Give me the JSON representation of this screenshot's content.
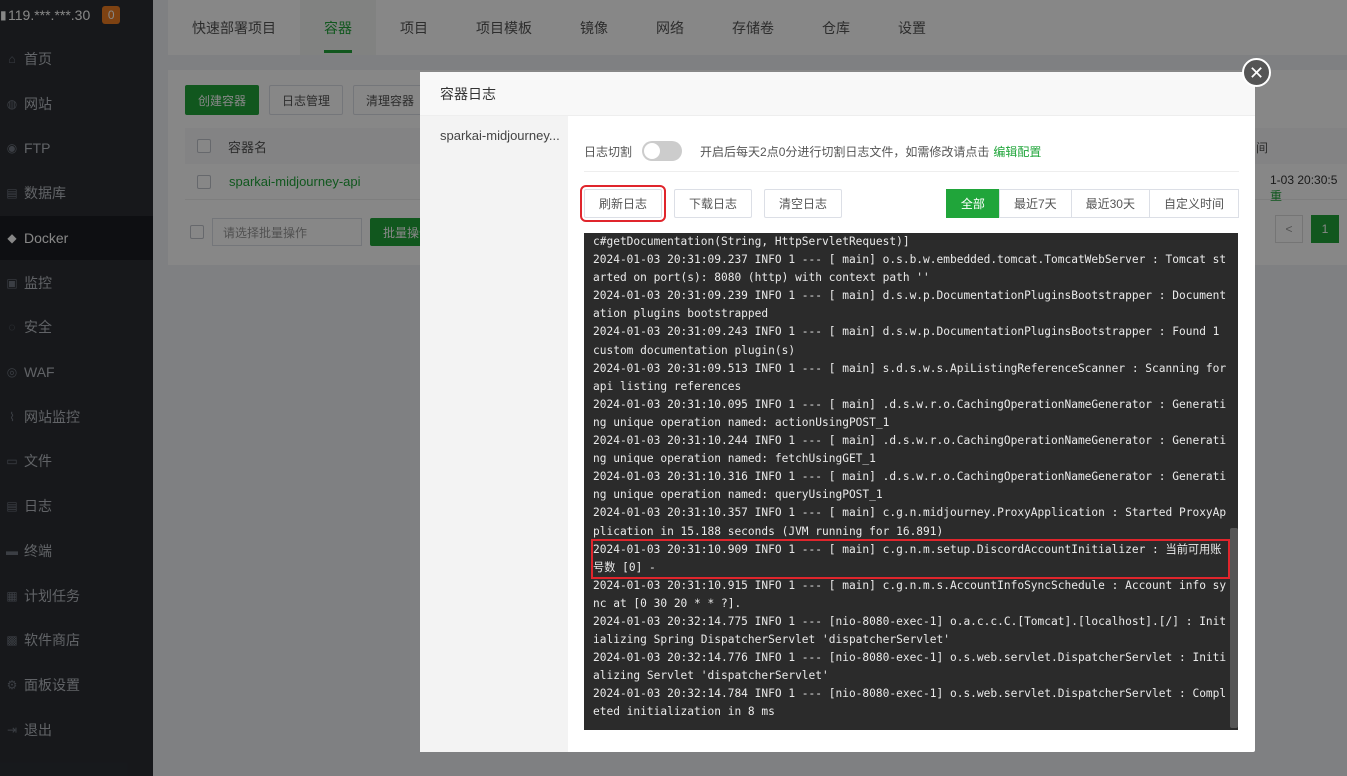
{
  "sidebar": {
    "server_ip": "119.***.***.30",
    "badge_count": "0",
    "items": [
      {
        "icon": "home-icon",
        "label": "首页"
      },
      {
        "icon": "globe-icon",
        "label": "网站"
      },
      {
        "icon": "ftp-icon",
        "label": "FTP"
      },
      {
        "icon": "database-icon",
        "label": "数据库"
      },
      {
        "icon": "docker-icon",
        "label": "Docker"
      },
      {
        "icon": "monitor-icon",
        "label": "监控"
      },
      {
        "icon": "shield-icon",
        "label": "安全"
      },
      {
        "icon": "waf-icon",
        "label": "WAF"
      },
      {
        "icon": "chart-icon",
        "label": "网站监控"
      },
      {
        "icon": "folder-icon",
        "label": "文件"
      },
      {
        "icon": "log-icon",
        "label": "日志"
      },
      {
        "icon": "terminal-icon",
        "label": "终端"
      },
      {
        "icon": "calendar-icon",
        "label": "计划任务"
      },
      {
        "icon": "grid-icon",
        "label": "软件商店"
      },
      {
        "icon": "settings-icon",
        "label": "面板设置"
      },
      {
        "icon": "logout-icon",
        "label": "退出"
      }
    ],
    "active_index": 4
  },
  "topbar": {
    "tabs": [
      "快速部署项目",
      "容器",
      "项目",
      "项目模板",
      "镜像",
      "网络",
      "存储卷",
      "仓库",
      "设置"
    ],
    "active_index": 1
  },
  "main": {
    "create_button": "创建容器",
    "log_manage_button": "日志管理",
    "clean_button": "清理容器",
    "col_name": "容器名",
    "col_time_partial": "间",
    "row_name": "sparkai-midjourney-api",
    "row_time_partial": "1-03 20:30:5",
    "row_status_partial": "重",
    "batch_placeholder": "请选择批量操作",
    "batch_button": "批量操作",
    "pager_prev": "<",
    "pager_page": "1"
  },
  "modal": {
    "title": "容器日志",
    "container_name": "sparkai-midjourney...",
    "cut_label": "日志切割",
    "cut_desc": "开启后每天2点0分进行切割日志文件，如需修改请点击",
    "cut_link": "编辑配置",
    "refresh_button": "刷新日志",
    "download_button": "下载日志",
    "clear_button": "清空日志",
    "ranges": [
      "全部",
      "最近7天",
      "最近30天",
      "自定义时间"
    ],
    "range_active_index": 0,
    "log_lines": [
      "c#getDocumentation(String, HttpServletRequest)]",
      "2024-01-03 20:31:09.237 INFO 1 --- [ main] o.s.b.w.embedded.tomcat.TomcatWebServer : Tomcat started on port(s): 8080 (http) with context path ''",
      "2024-01-03 20:31:09.239 INFO 1 --- [ main] d.s.w.p.DocumentationPluginsBootstrapper : Documentation plugins bootstrapped",
      "2024-01-03 20:31:09.243 INFO 1 --- [ main] d.s.w.p.DocumentationPluginsBootstrapper : Found 1 custom documentation plugin(s)",
      "2024-01-03 20:31:09.513 INFO 1 --- [ main] s.d.s.w.s.ApiListingReferenceScanner : Scanning for api listing references",
      "2024-01-03 20:31:10.095 INFO 1 --- [ main] .d.s.w.r.o.CachingOperationNameGenerator : Generating unique operation named: actionUsingPOST_1",
      "2024-01-03 20:31:10.244 INFO 1 --- [ main] .d.s.w.r.o.CachingOperationNameGenerator : Generating unique operation named: fetchUsingGET_1",
      "2024-01-03 20:31:10.316 INFO 1 --- [ main] .d.s.w.r.o.CachingOperationNameGenerator : Generating unique operation named: queryUsingPOST_1",
      "2024-01-03 20:31:10.357 INFO 1 --- [ main] c.g.n.midjourney.ProxyApplication : Started ProxyApplication in 15.188 seconds (JVM running for 16.891)",
      "2024-01-03 20:31:10.909 INFO 1 --- [ main] c.g.n.m.setup.DiscordAccountInitializer : 当前可用账号数 [0] -",
      "2024-01-03 20:31:10.915 INFO 1 --- [ main] c.g.n.m.s.AccountInfoSyncSchedule : Account info sync at [0 30 20 * * ?].",
      "2024-01-03 20:32:14.775 INFO 1 --- [nio-8080-exec-1] o.a.c.c.C.[Tomcat].[localhost].[/] : Initializing Spring DispatcherServlet 'dispatcherServlet'",
      "2024-01-03 20:32:14.776 INFO 1 --- [nio-8080-exec-1] o.s.web.servlet.DispatcherServlet : Initializing Servlet 'dispatcherServlet'",
      "2024-01-03 20:32:14.784 INFO 1 --- [nio-8080-exec-1] o.s.web.servlet.DispatcherServlet : Completed initialization in 8 ms"
    ],
    "highlighted_line_index": 9
  },
  "colors": {
    "accent": "#20a53a",
    "sidebar_bg": "#2c2f34",
    "highlight_border": "#e0252c",
    "log_bg": "#2b2b2b"
  }
}
